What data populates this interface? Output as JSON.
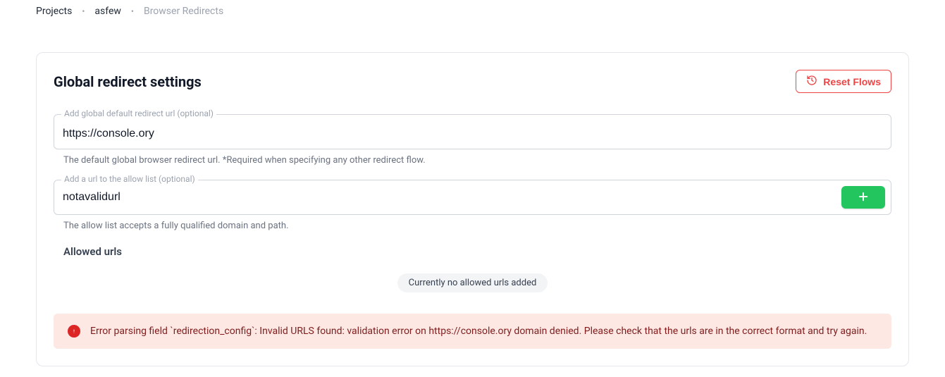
{
  "breadcrumb": {
    "items": [
      {
        "label": "Projects",
        "dim": false
      },
      {
        "label": "asfew",
        "dim": false
      },
      {
        "label": "Browser Redirects",
        "dim": true
      }
    ]
  },
  "header": {
    "title": "Global redirect settings",
    "reset_label": "Reset Flows"
  },
  "global_redirect": {
    "label": "Add global default redirect url (optional)",
    "value": "https://console.ory",
    "helper": "The default global browser redirect url. *Required when specifying any other redirect flow."
  },
  "allow_list_input": {
    "label": "Add a url to the allow list (optional)",
    "value": "notavalidurl",
    "helper": "The allow list accepts a fully qualified domain and path."
  },
  "allowed_urls": {
    "title": "Allowed urls",
    "empty_text": "Currently no allowed urls added"
  },
  "error": {
    "message": "Error parsing field `redirection_config`: Invalid URLS found: validation error on https://console.ory domain denied. Please check that the urls are in the correct format and try again."
  }
}
